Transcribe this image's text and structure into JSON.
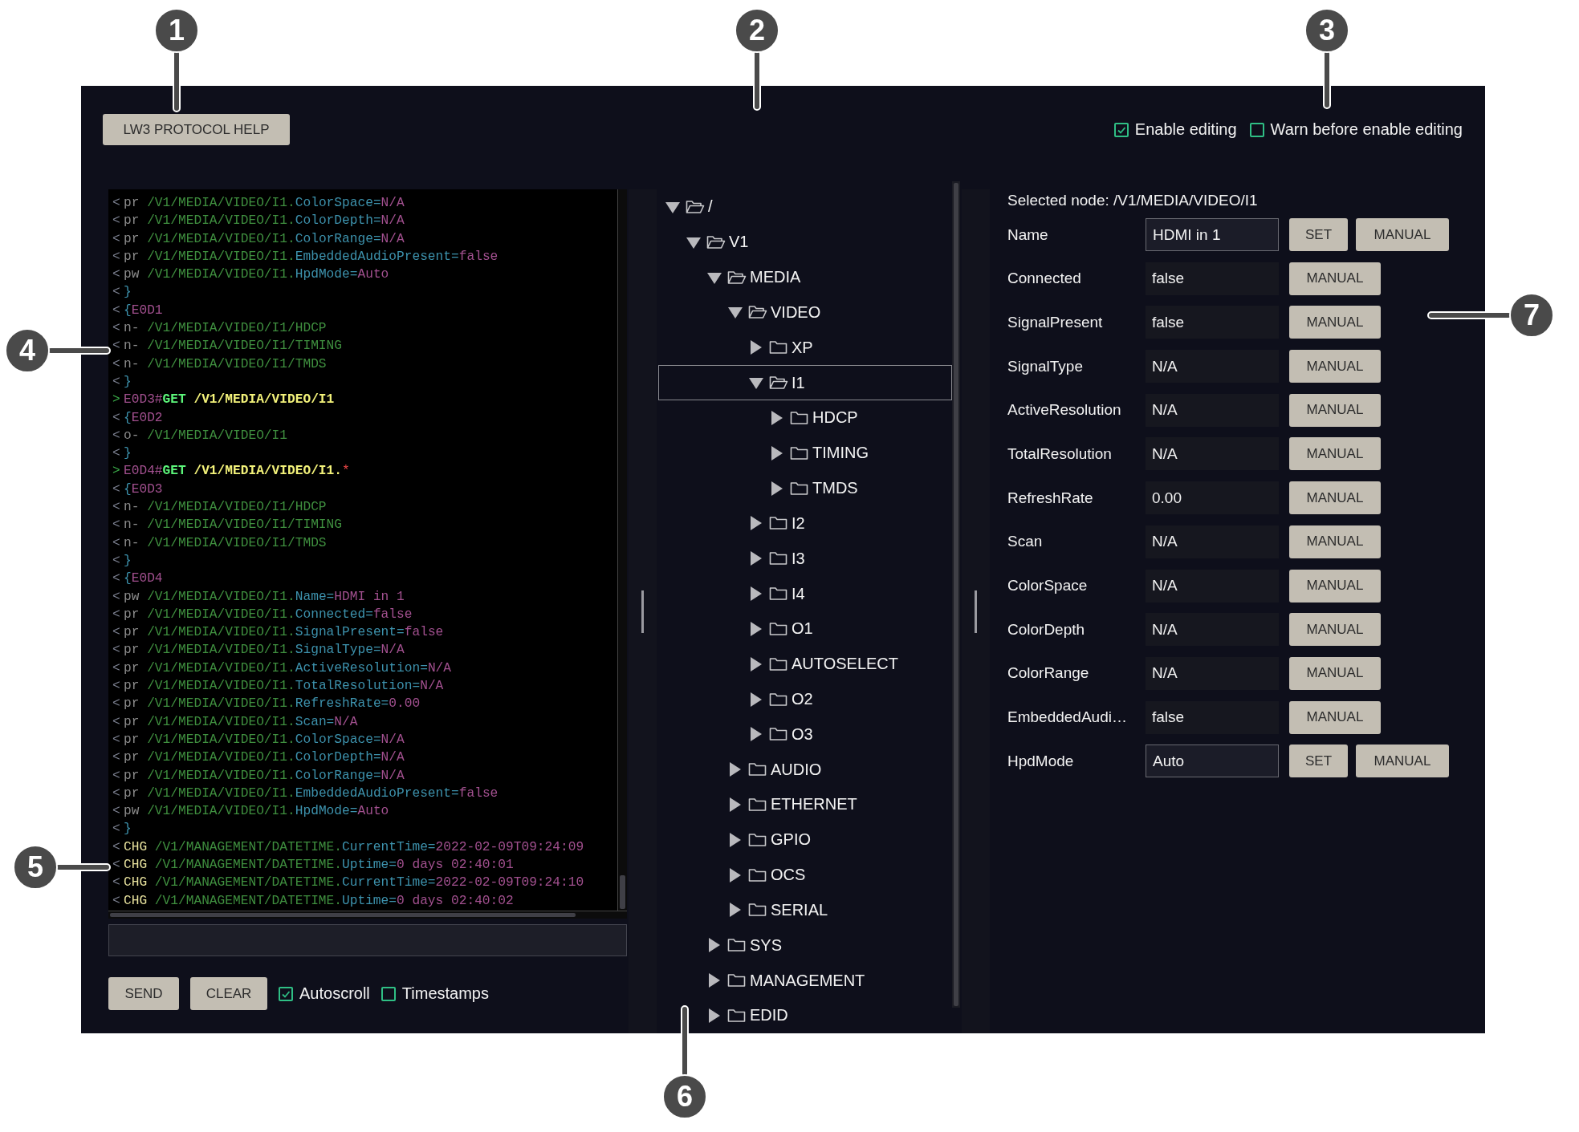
{
  "callouts": [
    {
      "number": "1"
    },
    {
      "number": "2"
    },
    {
      "number": "3"
    },
    {
      "number": "4"
    },
    {
      "number": "5"
    },
    {
      "number": "6"
    },
    {
      "number": "7"
    }
  ],
  "toolbar": {
    "help_button": "LW3 PROTOCOL HELP",
    "options": [
      {
        "label": "Enable editing",
        "checked": true
      },
      {
        "label": "Warn before enable editing",
        "checked": false
      }
    ]
  },
  "console": {
    "lines": [
      {
        "dir": "<",
        "segments": [
          {
            "kind": "prefix",
            "text": "pr "
          },
          {
            "kind": "path",
            "text": "/V1/MEDIA/VIDEO/I1."
          },
          {
            "kind": "prop",
            "text": "ColorSpace="
          },
          {
            "kind": "value",
            "text": "N/A"
          }
        ]
      },
      {
        "dir": "<",
        "segments": [
          {
            "kind": "prefix",
            "text": "pr "
          },
          {
            "kind": "path",
            "text": "/V1/MEDIA/VIDEO/I1."
          },
          {
            "kind": "prop",
            "text": "ColorDepth="
          },
          {
            "kind": "value",
            "text": "N/A"
          }
        ]
      },
      {
        "dir": "<",
        "segments": [
          {
            "kind": "prefix",
            "text": "pr "
          },
          {
            "kind": "path",
            "text": "/V1/MEDIA/VIDEO/I1."
          },
          {
            "kind": "prop",
            "text": "ColorRange="
          },
          {
            "kind": "value",
            "text": "N/A"
          }
        ]
      },
      {
        "dir": "<",
        "segments": [
          {
            "kind": "prefix",
            "text": "pr "
          },
          {
            "kind": "path",
            "text": "/V1/MEDIA/VIDEO/I1."
          },
          {
            "kind": "prop",
            "text": "EmbeddedAudioPresent="
          },
          {
            "kind": "value",
            "text": "false"
          }
        ]
      },
      {
        "dir": "<",
        "segments": [
          {
            "kind": "prefix",
            "text": "pw "
          },
          {
            "kind": "path",
            "text": "/V1/MEDIA/VIDEO/I1."
          },
          {
            "kind": "prop",
            "text": "HpdMode="
          },
          {
            "kind": "value",
            "text": "Auto"
          }
        ]
      },
      {
        "dir": "<",
        "segments": [
          {
            "kind": "brace",
            "text": "}"
          }
        ]
      },
      {
        "dir": "<",
        "segments": [
          {
            "kind": "brace",
            "text": "{"
          },
          {
            "kind": "id",
            "text": "E0D1"
          }
        ]
      },
      {
        "dir": "<",
        "segments": [
          {
            "kind": "prefix",
            "text": "n- "
          },
          {
            "kind": "path",
            "text": "/V1/MEDIA/VIDEO/I1/HDCP"
          }
        ]
      },
      {
        "dir": "<",
        "segments": [
          {
            "kind": "prefix",
            "text": "n- "
          },
          {
            "kind": "path",
            "text": "/V1/MEDIA/VIDEO/I1/TIMING"
          }
        ]
      },
      {
        "dir": "<",
        "segments": [
          {
            "kind": "prefix",
            "text": "n- "
          },
          {
            "kind": "path",
            "text": "/V1/MEDIA/VIDEO/I1/TMDS"
          }
        ]
      },
      {
        "dir": "<",
        "segments": [
          {
            "kind": "brace",
            "text": "}"
          }
        ]
      },
      {
        "dir": ">",
        "segments": [
          {
            "kind": "id",
            "text": "E0D3#"
          },
          {
            "kind": "cmd",
            "text": "GET "
          },
          {
            "kind": "target",
            "text": "/V1/MEDIA/VIDEO/I1"
          }
        ]
      },
      {
        "dir": "<",
        "segments": [
          {
            "kind": "brace",
            "text": "{"
          },
          {
            "kind": "id",
            "text": "E0D2"
          }
        ]
      },
      {
        "dir": "<",
        "segments": [
          {
            "kind": "prefix",
            "text": "o- "
          },
          {
            "kind": "path",
            "text": "/V1/MEDIA/VIDEO/I1"
          }
        ]
      },
      {
        "dir": "<",
        "segments": [
          {
            "kind": "brace",
            "text": "}"
          }
        ]
      },
      {
        "dir": ">",
        "segments": [
          {
            "kind": "id",
            "text": "E0D4#"
          },
          {
            "kind": "cmd",
            "text": "GET "
          },
          {
            "kind": "target",
            "text": "/V1/MEDIA/VIDEO/I1."
          },
          {
            "kind": "star",
            "text": "*"
          }
        ]
      },
      {
        "dir": "<",
        "segments": [
          {
            "kind": "brace",
            "text": "{"
          },
          {
            "kind": "id",
            "text": "E0D3"
          }
        ]
      },
      {
        "dir": "<",
        "segments": [
          {
            "kind": "prefix",
            "text": "n- "
          },
          {
            "kind": "path",
            "text": "/V1/MEDIA/VIDEO/I1/HDCP"
          }
        ]
      },
      {
        "dir": "<",
        "segments": [
          {
            "kind": "prefix",
            "text": "n- "
          },
          {
            "kind": "path",
            "text": "/V1/MEDIA/VIDEO/I1/TIMING"
          }
        ]
      },
      {
        "dir": "<",
        "segments": [
          {
            "kind": "prefix",
            "text": "n- "
          },
          {
            "kind": "path",
            "text": "/V1/MEDIA/VIDEO/I1/TMDS"
          }
        ]
      },
      {
        "dir": "<",
        "segments": [
          {
            "kind": "brace",
            "text": "}"
          }
        ]
      },
      {
        "dir": "<",
        "segments": [
          {
            "kind": "brace",
            "text": "{"
          },
          {
            "kind": "id",
            "text": "E0D4"
          }
        ]
      },
      {
        "dir": "<",
        "segments": [
          {
            "kind": "prefix",
            "text": "pw "
          },
          {
            "kind": "path",
            "text": "/V1/MEDIA/VIDEO/I1."
          },
          {
            "kind": "prop",
            "text": "Name="
          },
          {
            "kind": "value",
            "text": "HDMI in 1"
          }
        ]
      },
      {
        "dir": "<",
        "segments": [
          {
            "kind": "prefix",
            "text": "pr "
          },
          {
            "kind": "path",
            "text": "/V1/MEDIA/VIDEO/I1."
          },
          {
            "kind": "prop",
            "text": "Connected="
          },
          {
            "kind": "value",
            "text": "false"
          }
        ]
      },
      {
        "dir": "<",
        "segments": [
          {
            "kind": "prefix",
            "text": "pr "
          },
          {
            "kind": "path",
            "text": "/V1/MEDIA/VIDEO/I1."
          },
          {
            "kind": "prop",
            "text": "SignalPresent="
          },
          {
            "kind": "value",
            "text": "false"
          }
        ]
      },
      {
        "dir": "<",
        "segments": [
          {
            "kind": "prefix",
            "text": "pr "
          },
          {
            "kind": "path",
            "text": "/V1/MEDIA/VIDEO/I1."
          },
          {
            "kind": "prop",
            "text": "SignalType="
          },
          {
            "kind": "value",
            "text": "N/A"
          }
        ]
      },
      {
        "dir": "<",
        "segments": [
          {
            "kind": "prefix",
            "text": "pr "
          },
          {
            "kind": "path",
            "text": "/V1/MEDIA/VIDEO/I1."
          },
          {
            "kind": "prop",
            "text": "ActiveResolution="
          },
          {
            "kind": "value",
            "text": "N/A"
          }
        ]
      },
      {
        "dir": "<",
        "segments": [
          {
            "kind": "prefix",
            "text": "pr "
          },
          {
            "kind": "path",
            "text": "/V1/MEDIA/VIDEO/I1."
          },
          {
            "kind": "prop",
            "text": "TotalResolution="
          },
          {
            "kind": "value",
            "text": "N/A"
          }
        ]
      },
      {
        "dir": "<",
        "segments": [
          {
            "kind": "prefix",
            "text": "pr "
          },
          {
            "kind": "path",
            "text": "/V1/MEDIA/VIDEO/I1."
          },
          {
            "kind": "prop",
            "text": "RefreshRate="
          },
          {
            "kind": "value",
            "text": "0.00"
          }
        ]
      },
      {
        "dir": "<",
        "segments": [
          {
            "kind": "prefix",
            "text": "pr "
          },
          {
            "kind": "path",
            "text": "/V1/MEDIA/VIDEO/I1."
          },
          {
            "kind": "prop",
            "text": "Scan="
          },
          {
            "kind": "value",
            "text": "N/A"
          }
        ]
      },
      {
        "dir": "<",
        "segments": [
          {
            "kind": "prefix",
            "text": "pr "
          },
          {
            "kind": "path",
            "text": "/V1/MEDIA/VIDEO/I1."
          },
          {
            "kind": "prop",
            "text": "ColorSpace="
          },
          {
            "kind": "value",
            "text": "N/A"
          }
        ]
      },
      {
        "dir": "<",
        "segments": [
          {
            "kind": "prefix",
            "text": "pr "
          },
          {
            "kind": "path",
            "text": "/V1/MEDIA/VIDEO/I1."
          },
          {
            "kind": "prop",
            "text": "ColorDepth="
          },
          {
            "kind": "value",
            "text": "N/A"
          }
        ]
      },
      {
        "dir": "<",
        "segments": [
          {
            "kind": "prefix",
            "text": "pr "
          },
          {
            "kind": "path",
            "text": "/V1/MEDIA/VIDEO/I1."
          },
          {
            "kind": "prop",
            "text": "ColorRange="
          },
          {
            "kind": "value",
            "text": "N/A"
          }
        ]
      },
      {
        "dir": "<",
        "segments": [
          {
            "kind": "prefix",
            "text": "pr "
          },
          {
            "kind": "path",
            "text": "/V1/MEDIA/VIDEO/I1."
          },
          {
            "kind": "prop",
            "text": "EmbeddedAudioPresent="
          },
          {
            "kind": "value",
            "text": "false"
          }
        ]
      },
      {
        "dir": "<",
        "segments": [
          {
            "kind": "prefix",
            "text": "pw "
          },
          {
            "kind": "path",
            "text": "/V1/MEDIA/VIDEO/I1."
          },
          {
            "kind": "prop",
            "text": "HpdMode="
          },
          {
            "kind": "value",
            "text": "Auto"
          }
        ]
      },
      {
        "dir": "<",
        "segments": [
          {
            "kind": "brace",
            "text": "}"
          }
        ]
      },
      {
        "dir": "<",
        "segments": [
          {
            "kind": "chg",
            "text": "CHG "
          },
          {
            "kind": "path",
            "text": "/V1/MANAGEMENT/DATETIME."
          },
          {
            "kind": "prop",
            "text": "CurrentTime="
          },
          {
            "kind": "value",
            "text": "2022-02-09T09:24:09"
          }
        ]
      },
      {
        "dir": "<",
        "segments": [
          {
            "kind": "chg",
            "text": "CHG "
          },
          {
            "kind": "path",
            "text": "/V1/MANAGEMENT/DATETIME."
          },
          {
            "kind": "prop",
            "text": "Uptime="
          },
          {
            "kind": "value",
            "text": "0 days 02:40:01"
          }
        ]
      },
      {
        "dir": "<",
        "segments": [
          {
            "kind": "chg",
            "text": "CHG "
          },
          {
            "kind": "path",
            "text": "/V1/MANAGEMENT/DATETIME."
          },
          {
            "kind": "prop",
            "text": "CurrentTime="
          },
          {
            "kind": "value",
            "text": "2022-02-09T09:24:10"
          }
        ]
      },
      {
        "dir": "<",
        "segments": [
          {
            "kind": "chg",
            "text": "CHG "
          },
          {
            "kind": "path",
            "text": "/V1/MANAGEMENT/DATETIME."
          },
          {
            "kind": "prop",
            "text": "Uptime="
          },
          {
            "kind": "value",
            "text": "0 days 02:40:02"
          }
        ]
      }
    ],
    "buttons": [
      "SEND",
      "CLEAR"
    ],
    "options": [
      {
        "label": "Autoscroll",
        "checked": true
      },
      {
        "label": "Timestamps",
        "checked": false
      }
    ]
  },
  "tree": [
    {
      "label": "/",
      "expanded": true,
      "selected": false,
      "children": [
        {
          "label": "V1",
          "expanded": true,
          "selected": false,
          "children": [
            {
              "label": "MEDIA",
              "expanded": true,
              "selected": false,
              "children": [
                {
                  "label": "VIDEO",
                  "expanded": true,
                  "selected": false,
                  "children": [
                    {
                      "label": "XP",
                      "expanded": false,
                      "selected": false
                    },
                    {
                      "label": "I1",
                      "expanded": true,
                      "selected": true,
                      "children": [
                        {
                          "label": "HDCP",
                          "expanded": false,
                          "selected": false
                        },
                        {
                          "label": "TIMING",
                          "expanded": false,
                          "selected": false
                        },
                        {
                          "label": "TMDS",
                          "expanded": false,
                          "selected": false
                        }
                      ]
                    },
                    {
                      "label": "I2",
                      "expanded": false,
                      "selected": false
                    },
                    {
                      "label": "I3",
                      "expanded": false,
                      "selected": false
                    },
                    {
                      "label": "I4",
                      "expanded": false,
                      "selected": false
                    },
                    {
                      "label": "O1",
                      "expanded": false,
                      "selected": false
                    },
                    {
                      "label": "AUTOSELECT",
                      "expanded": false,
                      "selected": false
                    },
                    {
                      "label": "O2",
                      "expanded": false,
                      "selected": false
                    },
                    {
                      "label": "O3",
                      "expanded": false,
                      "selected": false
                    }
                  ]
                },
                {
                  "label": "AUDIO",
                  "expanded": false,
                  "selected": false
                },
                {
                  "label": "ETHERNET",
                  "expanded": false,
                  "selected": false
                },
                {
                  "label": "GPIO",
                  "expanded": false,
                  "selected": false
                },
                {
                  "label": "OCS",
                  "expanded": false,
                  "selected": false
                },
                {
                  "label": "SERIAL",
                  "expanded": false,
                  "selected": false
                }
              ]
            },
            {
              "label": "SYS",
              "expanded": false,
              "selected": false
            },
            {
              "label": "MANAGEMENT",
              "expanded": false,
              "selected": false
            },
            {
              "label": "EDID",
              "expanded": false,
              "selected": false
            }
          ]
        }
      ]
    }
  ],
  "properties": {
    "selected_node": "Selected node: /V1/MEDIA/VIDEO/I1",
    "rows": [
      {
        "label": "Name",
        "value": "HDMI in 1",
        "editable": true,
        "buttons": [
          "SET",
          "MANUAL"
        ]
      },
      {
        "label": "Connected",
        "value": "false",
        "editable": false,
        "buttons": [
          "MANUAL"
        ]
      },
      {
        "label": "SignalPresent",
        "value": "false",
        "editable": false,
        "buttons": [
          "MANUAL"
        ]
      },
      {
        "label": "SignalType",
        "value": "N/A",
        "editable": false,
        "buttons": [
          "MANUAL"
        ]
      },
      {
        "label": "ActiveResolution",
        "value": "N/A",
        "editable": false,
        "buttons": [
          "MANUAL"
        ]
      },
      {
        "label": "TotalResolution",
        "value": "N/A",
        "editable": false,
        "buttons": [
          "MANUAL"
        ]
      },
      {
        "label": "RefreshRate",
        "value": "0.00",
        "editable": false,
        "buttons": [
          "MANUAL"
        ]
      },
      {
        "label": "Scan",
        "value": "N/A",
        "editable": false,
        "buttons": [
          "MANUAL"
        ]
      },
      {
        "label": "ColorSpace",
        "value": "N/A",
        "editable": false,
        "buttons": [
          "MANUAL"
        ]
      },
      {
        "label": "ColorDepth",
        "value": "N/A",
        "editable": false,
        "buttons": [
          "MANUAL"
        ]
      },
      {
        "label": "ColorRange",
        "value": "N/A",
        "editable": false,
        "buttons": [
          "MANUAL"
        ]
      },
      {
        "label": "EmbeddedAudi…",
        "value": "false",
        "editable": false,
        "buttons": [
          "MANUAL"
        ]
      },
      {
        "label": "HpdMode",
        "value": "Auto",
        "editable": true,
        "buttons": [
          "SET",
          "MANUAL"
        ]
      }
    ]
  }
}
